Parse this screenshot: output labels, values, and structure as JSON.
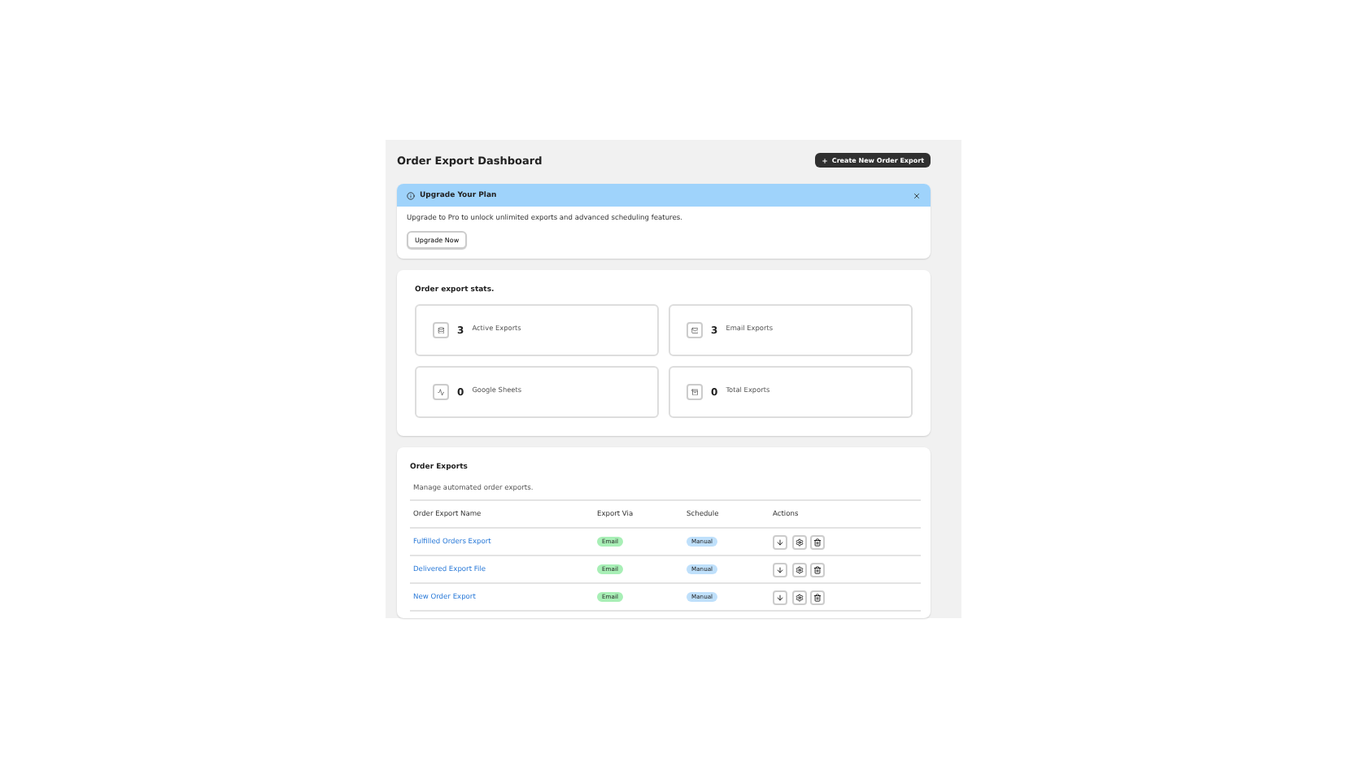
{
  "header": {
    "title": "Order Export Dashboard",
    "create_button": "Create New Order Export"
  },
  "banner": {
    "title": "Upgrade Your Plan",
    "message": "Upgrade to Pro to unlock unlimited exports and advanced scheduling features.",
    "button": "Upgrade Now"
  },
  "stats": {
    "title": "Order export stats.",
    "items": [
      {
        "kind": "active",
        "value": "3",
        "label": "Active Exports"
      },
      {
        "kind": "email",
        "value": "3",
        "label": "Email Exports"
      },
      {
        "kind": "sheets",
        "value": "0",
        "label": "Google Sheets"
      },
      {
        "kind": "total",
        "value": "0",
        "label": "Total Exports"
      }
    ]
  },
  "exports": {
    "title": "Order Exports",
    "subtitle": "Manage automated order exports.",
    "columns": [
      "Order Export Name",
      "Export Via",
      "Schedule",
      "Actions"
    ],
    "rows": [
      {
        "name": "Fulfilled Orders Export",
        "via": "Email",
        "schedule": "Manual"
      },
      {
        "name": "Delivered Export File",
        "via": "Email",
        "schedule": "Manual"
      },
      {
        "name": "New Order Export",
        "via": "Email",
        "schedule": "Manual"
      }
    ]
  }
}
